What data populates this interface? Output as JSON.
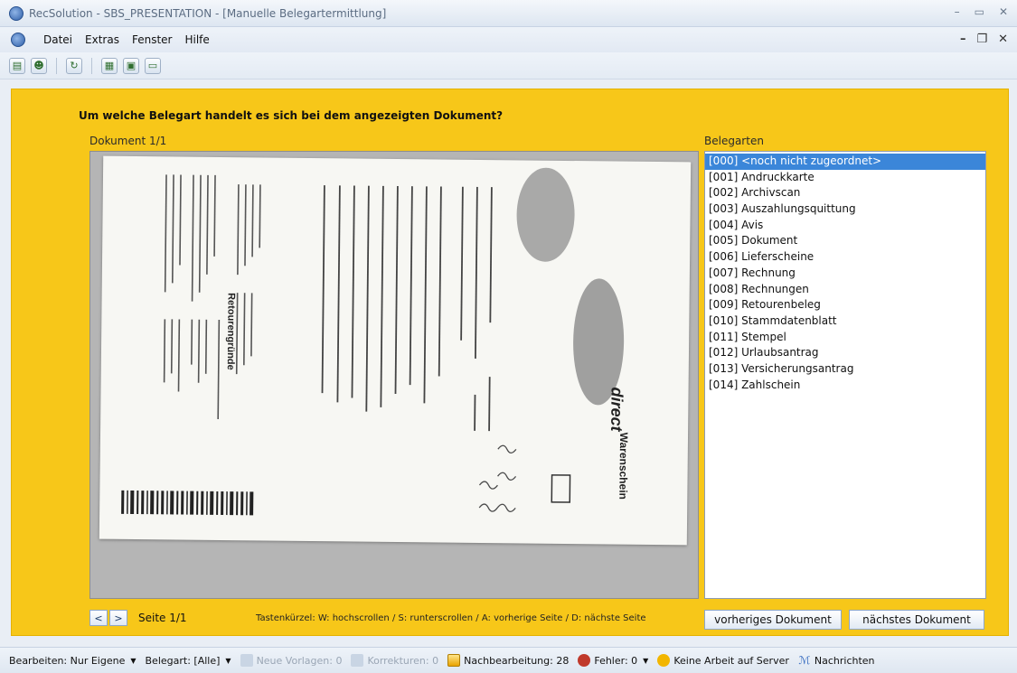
{
  "window": {
    "title": "RecSolution - SBS_PRESENTATION - [Manuelle Belegartermittlung]"
  },
  "menu": {
    "items": [
      "Datei",
      "Extras",
      "Fenster",
      "Hilfe"
    ]
  },
  "main": {
    "question": "Um welche Belegart handelt es sich bei dem angezeigten Dokument?",
    "doc_label": "Dokument 1/1",
    "types_label": "Belegarten",
    "page_label": "Seite 1/1",
    "shortcuts": "Tastenkürzel: W: hochscrollen  /  S: runterscrollen  /  A: vorherige Seite  /  D: nächste Seite",
    "prev_doc": "vorheriges Dokument",
    "next_doc": "nächstes Dokument",
    "nav_prev": "<",
    "nav_next": ">"
  },
  "belegarten": [
    "[000] <noch nicht zugeordnet>",
    "[001] Andruckkarte",
    "[002] Archivscan",
    "[003] Auszahlungsquittung",
    "[004] Avis",
    "[005] Dokument",
    "[006] Lieferscheine",
    "[007] Rechnung",
    "[008] Rechnungen",
    "[009] Retourenbeleg",
    "[010] Stammdatenblatt",
    "[011] Stempel",
    "[012] Urlaubsantrag",
    "[013] Versicherungsantrag",
    "[014] Zahlschein"
  ],
  "document": {
    "brand": "direct",
    "doc_title": "Warenschein",
    "section": "Retourengründe",
    "handwritten": [
      "1 42",
      "1 65",
      "1 65",
      "1 30",
      "1 42"
    ]
  },
  "statusbar": {
    "bearbeiten": "Bearbeiten: Nur Eigene",
    "belegart": "Belegart: [Alle]",
    "neue_vorlagen": "Neue Vorlagen: 0",
    "korrekturen": "Korrekturen: 0",
    "nachbearbeitung": "Nachbearbeitung: 28",
    "fehler": "Fehler: 0",
    "keine_arbeit": "Keine Arbeit auf Server",
    "nachrichten": "Nachrichten"
  },
  "colors": {
    "accent": "#f7c719",
    "selection": "#3b86d9"
  }
}
